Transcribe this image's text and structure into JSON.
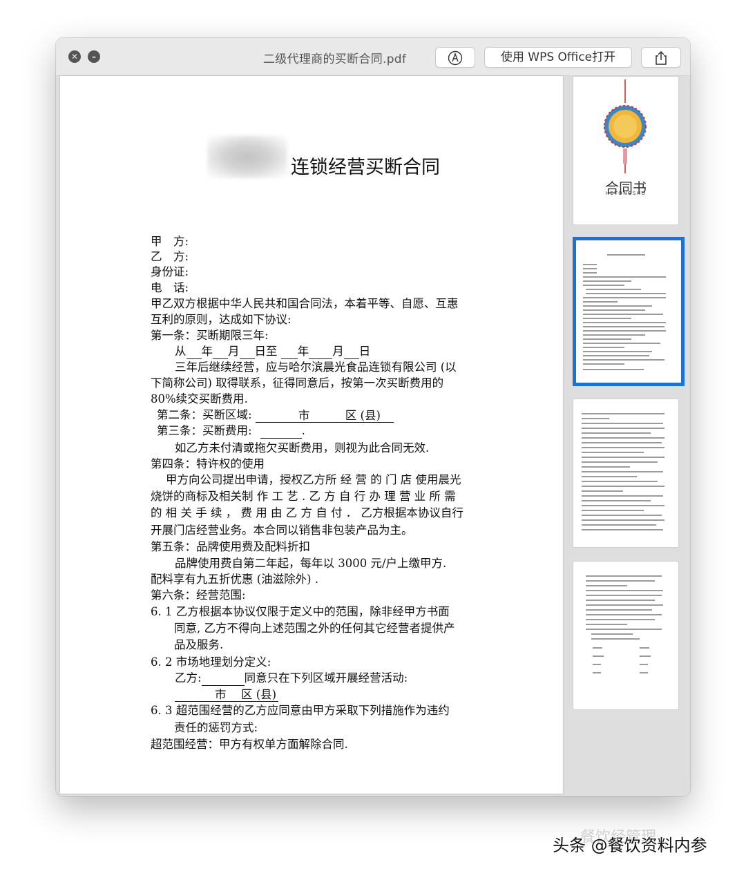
{
  "window": {
    "title": "二级代理商的买断合同.pdf",
    "close_glyph": "✕",
    "min_glyph": "–",
    "toolbar": {
      "open_with_label": "使用 WPS Office打开"
    }
  },
  "document": {
    "title": "连锁经营买断合同",
    "lines": [
      "甲　方:",
      "乙　方:",
      "身份证:",
      "电　话:",
      "甲乙双方根据中华人民共和国合同法，本着平等、自愿、互惠",
      "互利的原则，达成如下协议:",
      "第一条：买断期限三年:",
      "三年后继续经营，应与哈尔滨晨光食品连锁有限公司 (以",
      "下简称公司) 取得联系，征得同意后，按第一次买断费用的",
      "80%续交买断费用.",
      "如乙方未付清或拖欠买断费用，则视为此合同无效.",
      "第四条：特许权的使用",
      "甲方向公司提出申请，授权乙方所 经 营 的 门 店 使用晨光",
      "烧饼的商标及相关制 作 工 艺 . 乙 方 自 行 办 理 营 业 所 需",
      "的 相 关 手 续 ， 费 用 由 乙 方 自 付 ． 乙方根据本协议自行",
      "开展门店经营业务。本合同以销售非包装产品为主。",
      "第五条：品牌使用费及配料折扣",
      "品牌使用费自第二年起，每年以 3000 元/户上缴甲方.",
      "配料享有九五折优惠 (油滋除外) .",
      "第六条：经营范围:",
      "6. 1 乙方根据本协议仅限于定义中的范围，除非经甲方书面",
      "同意, 乙方不得向上述范围之外的任何其它经营者提供产",
      "品及服务.",
      "6. 2 市场地理划分定义:",
      "6. 3 超范围经营的乙方应同意由甲方采取下列措施作为违约",
      "责任的惩罚方式:",
      "超范围经营：甲方有权单方面解除合同."
    ],
    "period": {
      "from": "从",
      "year": "年",
      "month": "月",
      "day_to": "日至",
      "day": "日"
    },
    "article2": {
      "label": "第二条：买断区域:",
      "city": "市",
      "district": "区 (县)"
    },
    "article3": {
      "label": "第三条：买断费用:",
      "end": "."
    },
    "party_b_line": {
      "label": "乙方:",
      "text": "同意只在下列区域开展经营活动:"
    },
    "area_line": {
      "city": "市",
      "district": "区 (县)"
    },
    "trailing_dot": "."
  },
  "thumbnails": {
    "cover": {
      "title": "合同书",
      "subtitle": "HETONGSHU"
    }
  },
  "watermark": {
    "text": "头条 @餐饮资料内参",
    "under_text": "餐饮经管理"
  }
}
